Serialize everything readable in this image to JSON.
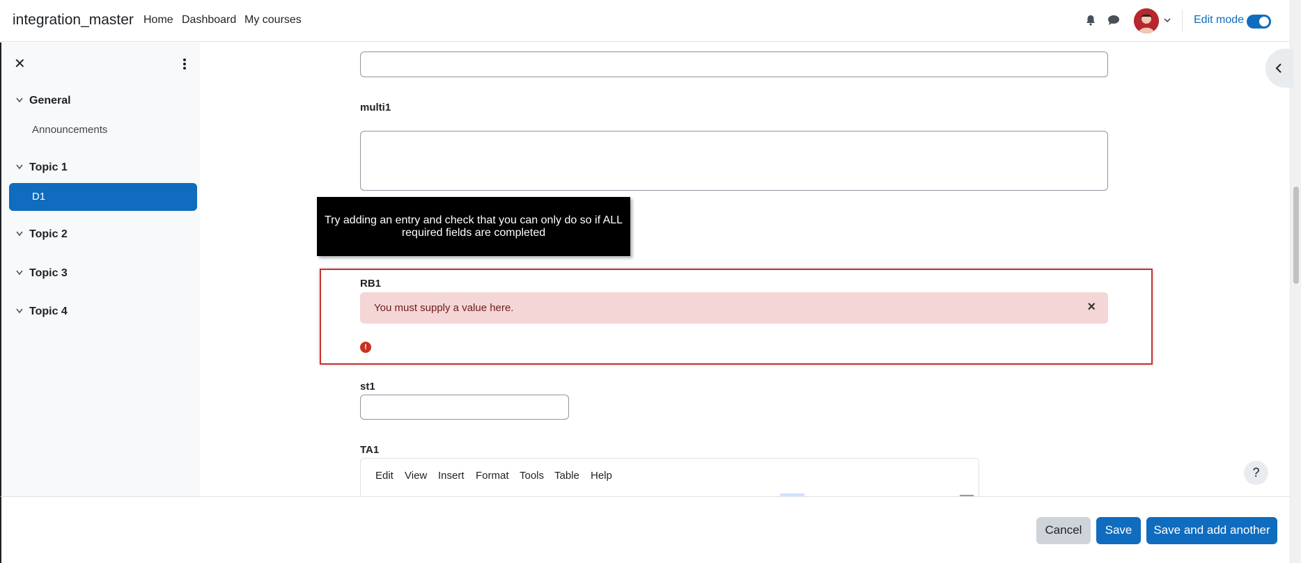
{
  "navbar": {
    "brand": "integration_master",
    "links": [
      "Home",
      "Dashboard",
      "My courses"
    ],
    "edit_mode_label": "Edit mode",
    "edit_mode_on": true
  },
  "drawer": {
    "sections": [
      {
        "title": "General",
        "items": [
          "Announcements"
        ]
      },
      {
        "title": "Topic 1",
        "items": [
          "D1"
        ]
      },
      {
        "title": "Topic 2",
        "items": []
      },
      {
        "title": "Topic 3",
        "items": []
      },
      {
        "title": "Topic 4",
        "items": []
      }
    ],
    "active_item": "D1"
  },
  "form": {
    "multi1_label": "multi1",
    "tooltip": "Try adding an entry and check that you can only do so if ALL required fields are completed",
    "rb1_label": "RB1",
    "rb1_error": "You must supply a value here.",
    "st1_label": "st1",
    "ta1_label": "TA1",
    "editor_menu": [
      "Edit",
      "View",
      "Insert",
      "Format",
      "Tools",
      "Table",
      "Help"
    ]
  },
  "footer": {
    "cancel": "Cancel",
    "save": "Save",
    "save_add": "Save and add another"
  },
  "help_label": "?",
  "colors": {
    "primary": "#0f6cbf",
    "error": "#ca3120",
    "error_bg": "#f4d6d6"
  }
}
